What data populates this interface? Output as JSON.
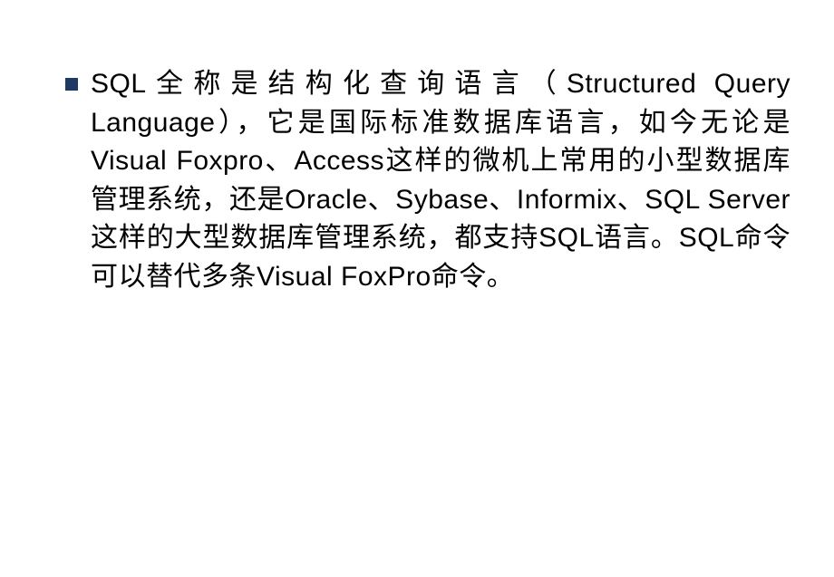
{
  "slide": {
    "bullets": [
      {
        "text": "SQL全称是结构化查询语言（Structured Query Language），它是国际标准数据库语言，如今无论是Visual Foxpro、Access这样的微机上常用的小型数据库管理系统，还是Oracle、Sybase、Informix、SQL Server这样的大型数据库管理系统，都支持SQL语言。SQL命令可以替代多条Visual FoxPro命令。"
      }
    ]
  }
}
